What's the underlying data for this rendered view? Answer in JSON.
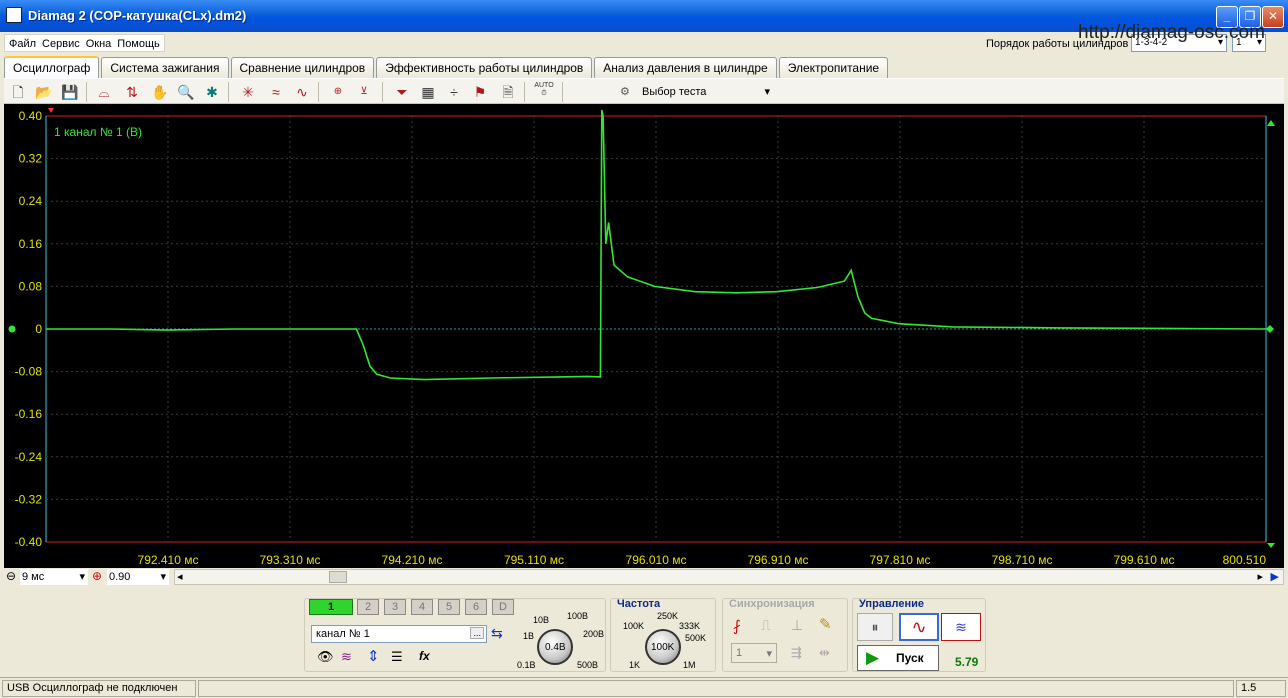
{
  "window": {
    "title": "Diamag 2 (COP-катушка(CLx).dm2)"
  },
  "watermark": "http://diamag-osc.com",
  "menu": [
    "Файл",
    "Сервис",
    "Окна",
    "Помощь"
  ],
  "cylinder_order": {
    "label": "Порядок работы цилиндров",
    "value": "1-3-4-2",
    "cylinder": "1"
  },
  "tabs": [
    "Осциллограф",
    "Система зажигания",
    "Сравнение цилиндров",
    "Эффективность работы цилиндров",
    "Анализ давления в цилиндре",
    "Электропитание"
  ],
  "toolbar": {
    "auto_label": "AUTO",
    "test_select": "Выбор теста"
  },
  "chart_data": {
    "type": "line",
    "series": [
      {
        "name": "1  канал № 1 (В)",
        "color": "#33e633"
      }
    ],
    "y_ticks": [
      "0.40",
      "0.32",
      "0.24",
      "0.16",
      "0.08",
      "0",
      "-0.08",
      "-0.16",
      "-0.24",
      "-0.32",
      "-0.40"
    ],
    "x_ticks": [
      "792.410 мс",
      "793.310 мс",
      "794.210 мс",
      "795.110 мс",
      "796.010 мс",
      "796.910 мс",
      "797.810 мс",
      "798.710 мс",
      "799.610 мс",
      "800.510"
    ],
    "ylim": [
      -0.4,
      0.4
    ],
    "xlim": [
      791.51,
      800.51
    ],
    "x": [
      791.51,
      792.0,
      792.4,
      792.9,
      793.2,
      793.8,
      793.85,
      793.9,
      793.95,
      794.05,
      794.3,
      794.8,
      795.3,
      795.5,
      795.6,
      795.61,
      795.62,
      795.64,
      795.66,
      795.7,
      795.8,
      796.0,
      796.3,
      796.6,
      796.9,
      797.2,
      797.4,
      797.45,
      797.5,
      797.55,
      797.6,
      797.8,
      798.2,
      799.0,
      800.51
    ],
    "y": [
      0.0,
      0.0,
      -0.002,
      0.0,
      0.0,
      0.0,
      -0.03,
      -0.07,
      -0.085,
      -0.092,
      -0.095,
      -0.092,
      -0.09,
      -0.089,
      -0.09,
      0.42,
      0.4,
      0.16,
      0.2,
      0.12,
      0.098,
      0.08,
      0.07,
      0.068,
      0.07,
      0.078,
      0.09,
      0.11,
      0.06,
      0.03,
      0.02,
      0.01,
      0.004,
      0.002,
      0.0
    ],
    "grid": true
  },
  "timebase": {
    "value": "9 мс"
  },
  "zoom": {
    "value": "0.90"
  },
  "channels": {
    "buttons": [
      "1",
      "2",
      "3",
      "4",
      "5",
      "6",
      "D"
    ],
    "selected_name": "канал № 1"
  },
  "voltage_knob": {
    "value": "0.4В",
    "labels": [
      "10В",
      "100В",
      "1В",
      "200В",
      "0.1В",
      "500В"
    ]
  },
  "frequency": {
    "title": "Частота",
    "value": "100K",
    "labels": [
      "250K",
      "100K",
      "333K",
      "500K",
      "1K",
      "1M"
    ]
  },
  "sync": {
    "title": "Синхронизация",
    "value": "1"
  },
  "control": {
    "title": "Управление",
    "start_label": "Пуск",
    "value": "5.79"
  },
  "status": {
    "left": "USB Осциллограф не подключен",
    "right": "1.5"
  }
}
